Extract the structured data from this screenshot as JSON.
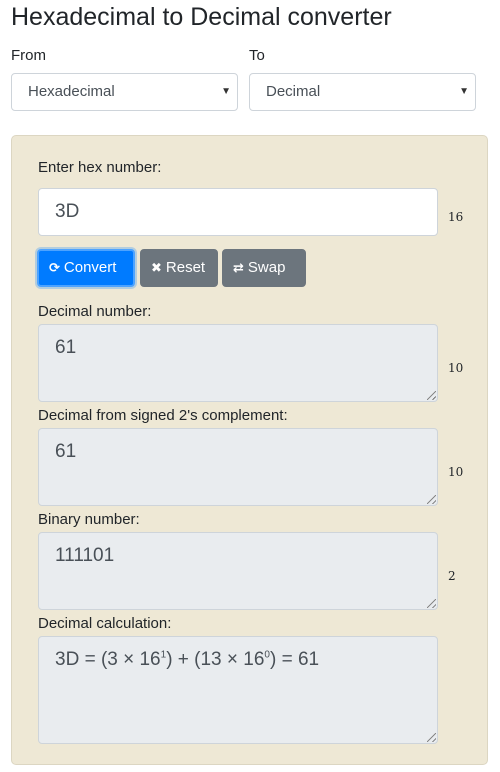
{
  "page": {
    "title": "Hexadecimal to Decimal converter"
  },
  "from": {
    "label": "From",
    "selected": "Hexadecimal"
  },
  "to": {
    "label": "To",
    "selected": "Decimal"
  },
  "input": {
    "label": "Enter hex number:",
    "value": "3D",
    "base": "16"
  },
  "buttons": {
    "convert": "Convert",
    "reset": "Reset",
    "swap": "Swap"
  },
  "decimal": {
    "label": "Decimal number:",
    "value": "61",
    "base": "10"
  },
  "signed": {
    "label": "Decimal from signed 2's complement:",
    "value": "61",
    "base": "10"
  },
  "binary": {
    "label": "Binary number:",
    "value": "111101",
    "base": "2"
  },
  "calculation": {
    "label": "Decimal calculation:",
    "parts": [
      "3D = (3 × 16",
      "1",
      ") + (13 × 16",
      "0",
      ") = 61"
    ]
  },
  "icons": {
    "convert": "refresh-icon",
    "reset": "x-icon",
    "swap": "swap-icon",
    "caret": "caret-down-icon"
  }
}
